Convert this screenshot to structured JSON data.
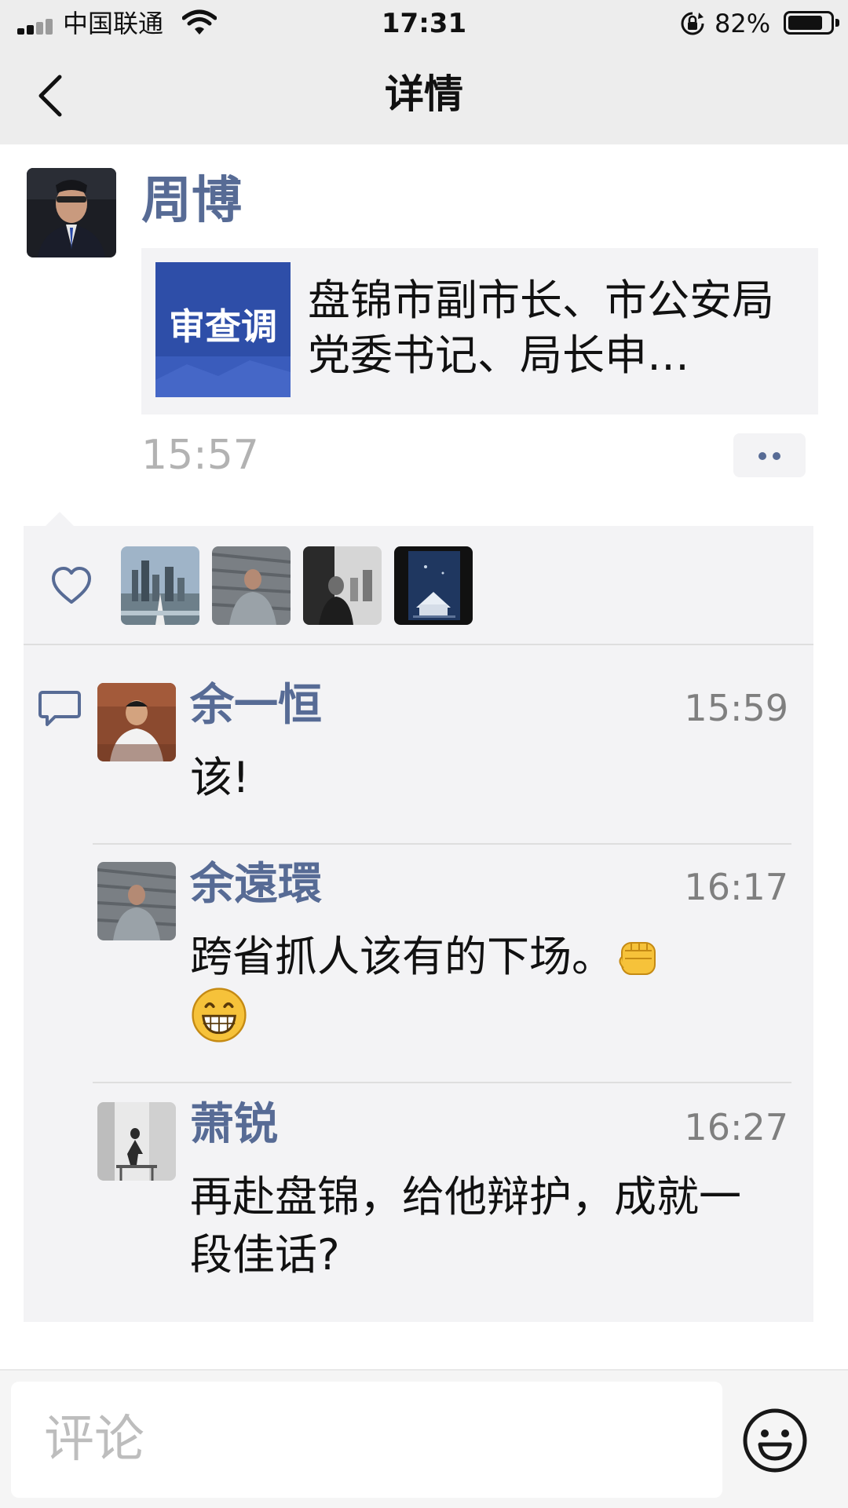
{
  "status_bar": {
    "carrier": "中国联通",
    "time": "17:31",
    "battery_percent_text": "82%",
    "battery_level": 0.82
  },
  "nav": {
    "title": "详情"
  },
  "post": {
    "author": "周博",
    "time": "15:57",
    "link": {
      "thumbnail_text": "审查调",
      "title": "盘锦市副市长、市公安局党委书记、局长申…"
    }
  },
  "likes": {
    "icon": "heart-outline-icon",
    "avatars": [
      "city-skyline-photo",
      "man-in-chair-photo",
      "man-at-window-photo",
      "book-cover-photo"
    ]
  },
  "comments": [
    {
      "author": "余一恒",
      "time": "15:59",
      "text": "该!"
    },
    {
      "author": "余遠環",
      "time": "16:17",
      "text": "跨省抓人该有的下场。",
      "emojis": [
        "fist-emoji",
        "grin-emoji"
      ]
    },
    {
      "author": "萧锐",
      "time": "16:27",
      "text": "再赴盘锦，给他辩护，成就一段佳话?"
    }
  ],
  "composer": {
    "placeholder": "评论",
    "emoji_button_icon": "smiley-face-icon"
  },
  "colors": {
    "link_blue": "#576b95",
    "bar_gray": "#ededed",
    "panel_gray": "#f3f3f5"
  }
}
